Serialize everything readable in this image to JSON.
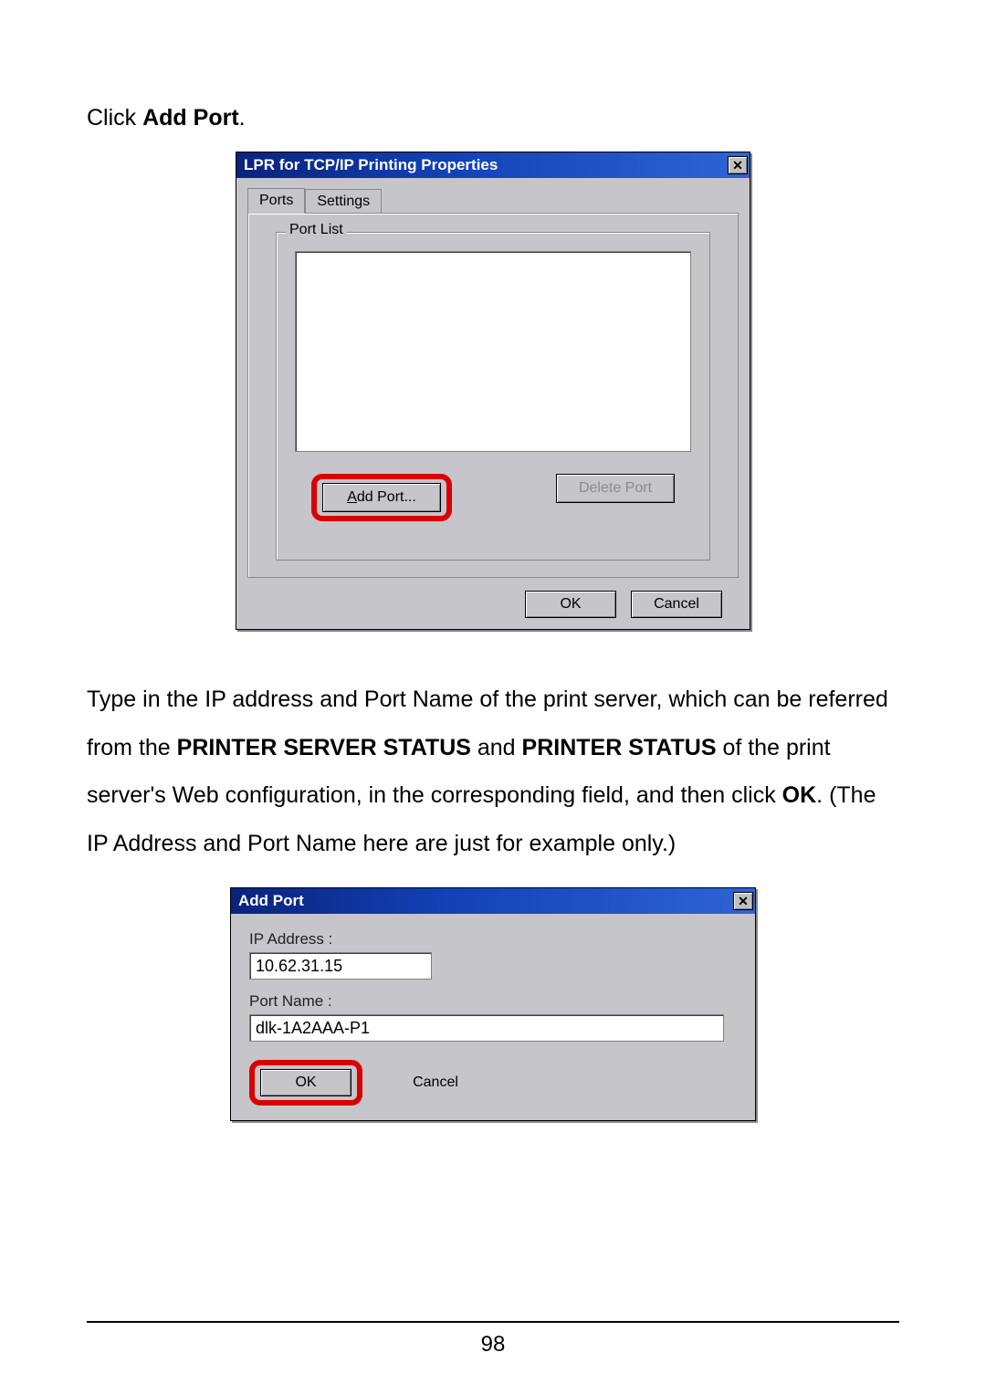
{
  "instruction1_prefix": "Click ",
  "instruction1_bold": "Add Port",
  "instruction1_suffix": ".",
  "dialog1": {
    "title": "LPR for TCP/IP Printing Properties",
    "close_glyph": "✕",
    "tabs": {
      "ports": "Ports",
      "settings": "Settings"
    },
    "group_label": "Port List",
    "add_port_prefix": "A",
    "add_port_rest": "dd Port...",
    "delete_port": "Delete Port",
    "ok": "OK",
    "cancel": "Cancel"
  },
  "paragraph": {
    "t1": "Type in the IP address and Port Name of the print server, which can be referred from the ",
    "b1": "PRINTER SERVER STATUS",
    "t2": " and ",
    "b2": "PRINTER STATUS",
    "t3": " of the print server's Web configuration, in the corresponding field, and then click ",
    "b3": "OK",
    "t4": ". (The IP Address and Port Name here are just for example only.)"
  },
  "dialog2": {
    "title": "Add Port",
    "close_glyph": "✕",
    "ip_label": "IP Address :",
    "ip_value": "10.62.31.15",
    "portname_label": "Port Name :",
    "portname_value": "dlk-1A2AAA-P1",
    "ok": "OK",
    "cancel": "Cancel"
  },
  "page_number": "98"
}
